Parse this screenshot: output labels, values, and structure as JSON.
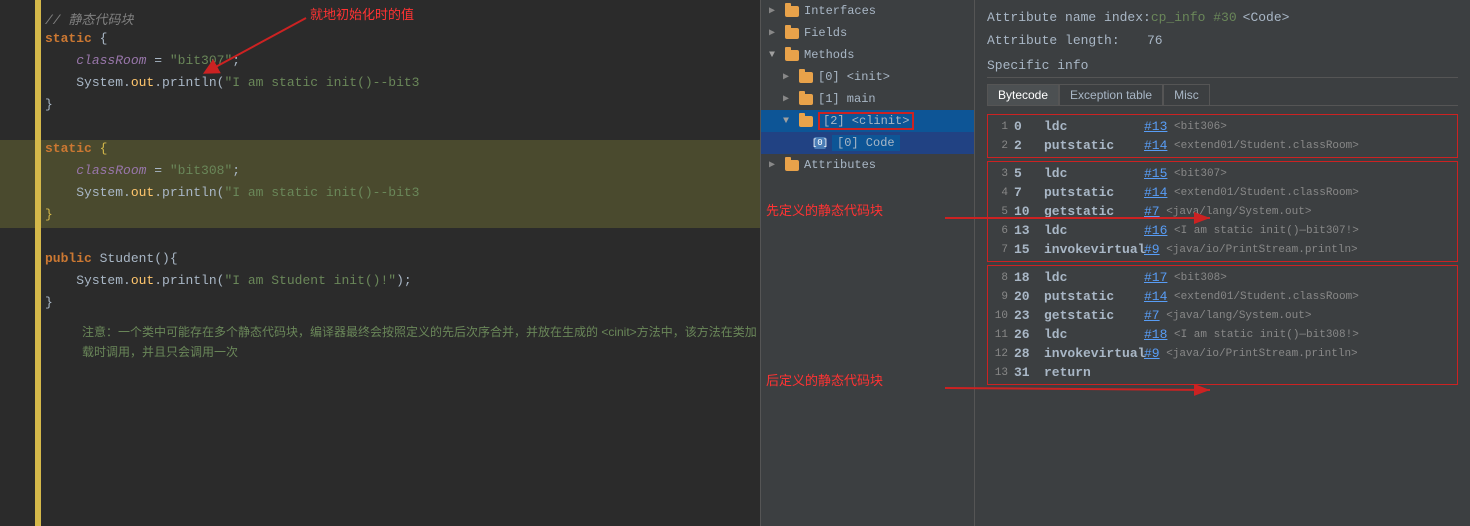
{
  "tree": {
    "items": [
      {
        "label": "Interfaces",
        "indent": 0,
        "type": "folder",
        "arrow": "▶",
        "selected": false
      },
      {
        "label": "Fields",
        "indent": 0,
        "type": "folder",
        "arrow": "▶",
        "selected": false
      },
      {
        "label": "Methods",
        "indent": 0,
        "type": "folder",
        "arrow": "▼",
        "selected": false
      },
      {
        "label": "[0] <init>",
        "indent": 1,
        "type": "folder",
        "arrow": "▶",
        "selected": false
      },
      {
        "label": "[1] main",
        "indent": 1,
        "type": "folder",
        "arrow": "▶",
        "selected": false
      },
      {
        "label": "[2] <clinit>",
        "indent": 1,
        "type": "folder",
        "arrow": "▼",
        "selected": true
      },
      {
        "label": "[0] Code",
        "indent": 2,
        "type": "code",
        "arrow": "",
        "selected": true,
        "inner": true
      },
      {
        "label": "Attributes",
        "indent": 0,
        "type": "folder",
        "arrow": "▶",
        "selected": false
      }
    ]
  },
  "info": {
    "attr_name_label": "Attribute name index:",
    "attr_name_value_ref": "cp_info #30",
    "attr_name_value_text": "<Code>",
    "attr_length_label": "Attribute length:",
    "attr_length_value": "76",
    "specific_info_label": "Specific info",
    "tabs": [
      "Bytecode",
      "Exception table",
      "Misc"
    ],
    "active_tab": "Bytecode"
  },
  "bytecode": {
    "rows": [
      {
        "rownum": "1",
        "offset": "0",
        "instr": "ldc",
        "ref": "#13",
        "comment": "<bit306>",
        "group": "top"
      },
      {
        "rownum": "2",
        "offset": "2",
        "instr": "putstatic",
        "ref": "#14",
        "comment": "<extend01/Student.classRoom>",
        "group": "top"
      },
      {
        "rownum": "3",
        "offset": "5",
        "instr": "ldc",
        "ref": "#15",
        "comment": "<bit307>",
        "group": "mid"
      },
      {
        "rownum": "4",
        "offset": "7",
        "instr": "putstatic",
        "ref": "#14",
        "comment": "<extend01/Student.classRoom>",
        "group": "mid"
      },
      {
        "rownum": "5",
        "offset": "10",
        "instr": "getstatic",
        "ref": "#7",
        "comment": "<java/lang/System.out>",
        "group": "mid"
      },
      {
        "rownum": "6",
        "offset": "13",
        "instr": "ldc",
        "ref": "#16",
        "comment": "<I am static init()—bit307!>",
        "group": "mid"
      },
      {
        "rownum": "7",
        "offset": "15",
        "instr": "invokevirtual",
        "ref": "#9",
        "comment": "<java/io/PrintStream.println>",
        "group": "mid"
      },
      {
        "rownum": "8",
        "offset": "18",
        "instr": "ldc",
        "ref": "#17",
        "comment": "<bit308>",
        "group": "bot"
      },
      {
        "rownum": "9",
        "offset": "20",
        "instr": "putstatic",
        "ref": "#14",
        "comment": "<extend01/Student.classRoom>",
        "group": "bot"
      },
      {
        "rownum": "10",
        "offset": "23",
        "instr": "getstatic",
        "ref": "#7",
        "comment": "<java/lang/System.out>",
        "group": "bot"
      },
      {
        "rownum": "11",
        "offset": "26",
        "instr": "ldc",
        "ref": "#18",
        "comment": "<I am static init()—bit308!>",
        "group": "bot"
      },
      {
        "rownum": "12",
        "offset": "28",
        "instr": "invokevirtual",
        "ref": "#9",
        "comment": "<java/io/PrintStream.println>",
        "group": "bot"
      },
      {
        "rownum": "13",
        "offset": "31",
        "instr": "return",
        "ref": "",
        "comment": "",
        "group": "bot"
      }
    ]
  },
  "annotations": {
    "just_in_time": "就地初始化时的值",
    "pre_defined_static": "先定义的静态代码块",
    "post_defined_static": "后定义的静态代码块",
    "note": "注意：一个类中可能存在多个静态代码块，编译器最终会按照定义的先后次序合并，并放在生成的\n<cinit>方法中，该方法在类加载时调用，并且只会调用一次"
  },
  "code": {
    "comment": "// 静态代码块",
    "lines": [
      {
        "num": "",
        "text": "// 静态代码块",
        "type": "comment"
      },
      {
        "num": "",
        "text": "static {",
        "type": "static-open"
      },
      {
        "num": "",
        "text": "    classRoom = \"bit307\";",
        "type": "assign"
      },
      {
        "num": "",
        "text": "    System.out.println(\"I am static init()--bit3",
        "type": "println"
      },
      {
        "num": "",
        "text": "}",
        "type": "brace"
      },
      {
        "num": "",
        "text": "",
        "type": "blank"
      },
      {
        "num": "",
        "text": "static {",
        "type": "static-open2"
      },
      {
        "num": "",
        "text": "    classRoom = \"bit308\";",
        "type": "assign2"
      },
      {
        "num": "",
        "text": "    System.out.println(\"I am static init()--bit3",
        "type": "println2"
      },
      {
        "num": "",
        "text": "}",
        "type": "brace2"
      },
      {
        "num": "",
        "text": "",
        "type": "blank2"
      },
      {
        "num": "",
        "text": "public Student(){",
        "type": "constructor"
      },
      {
        "num": "",
        "text": "    System.out.println(\"I am Student init()!\");",
        "type": "println3"
      },
      {
        "num": "",
        "text": "}",
        "type": "brace3"
      }
    ]
  }
}
